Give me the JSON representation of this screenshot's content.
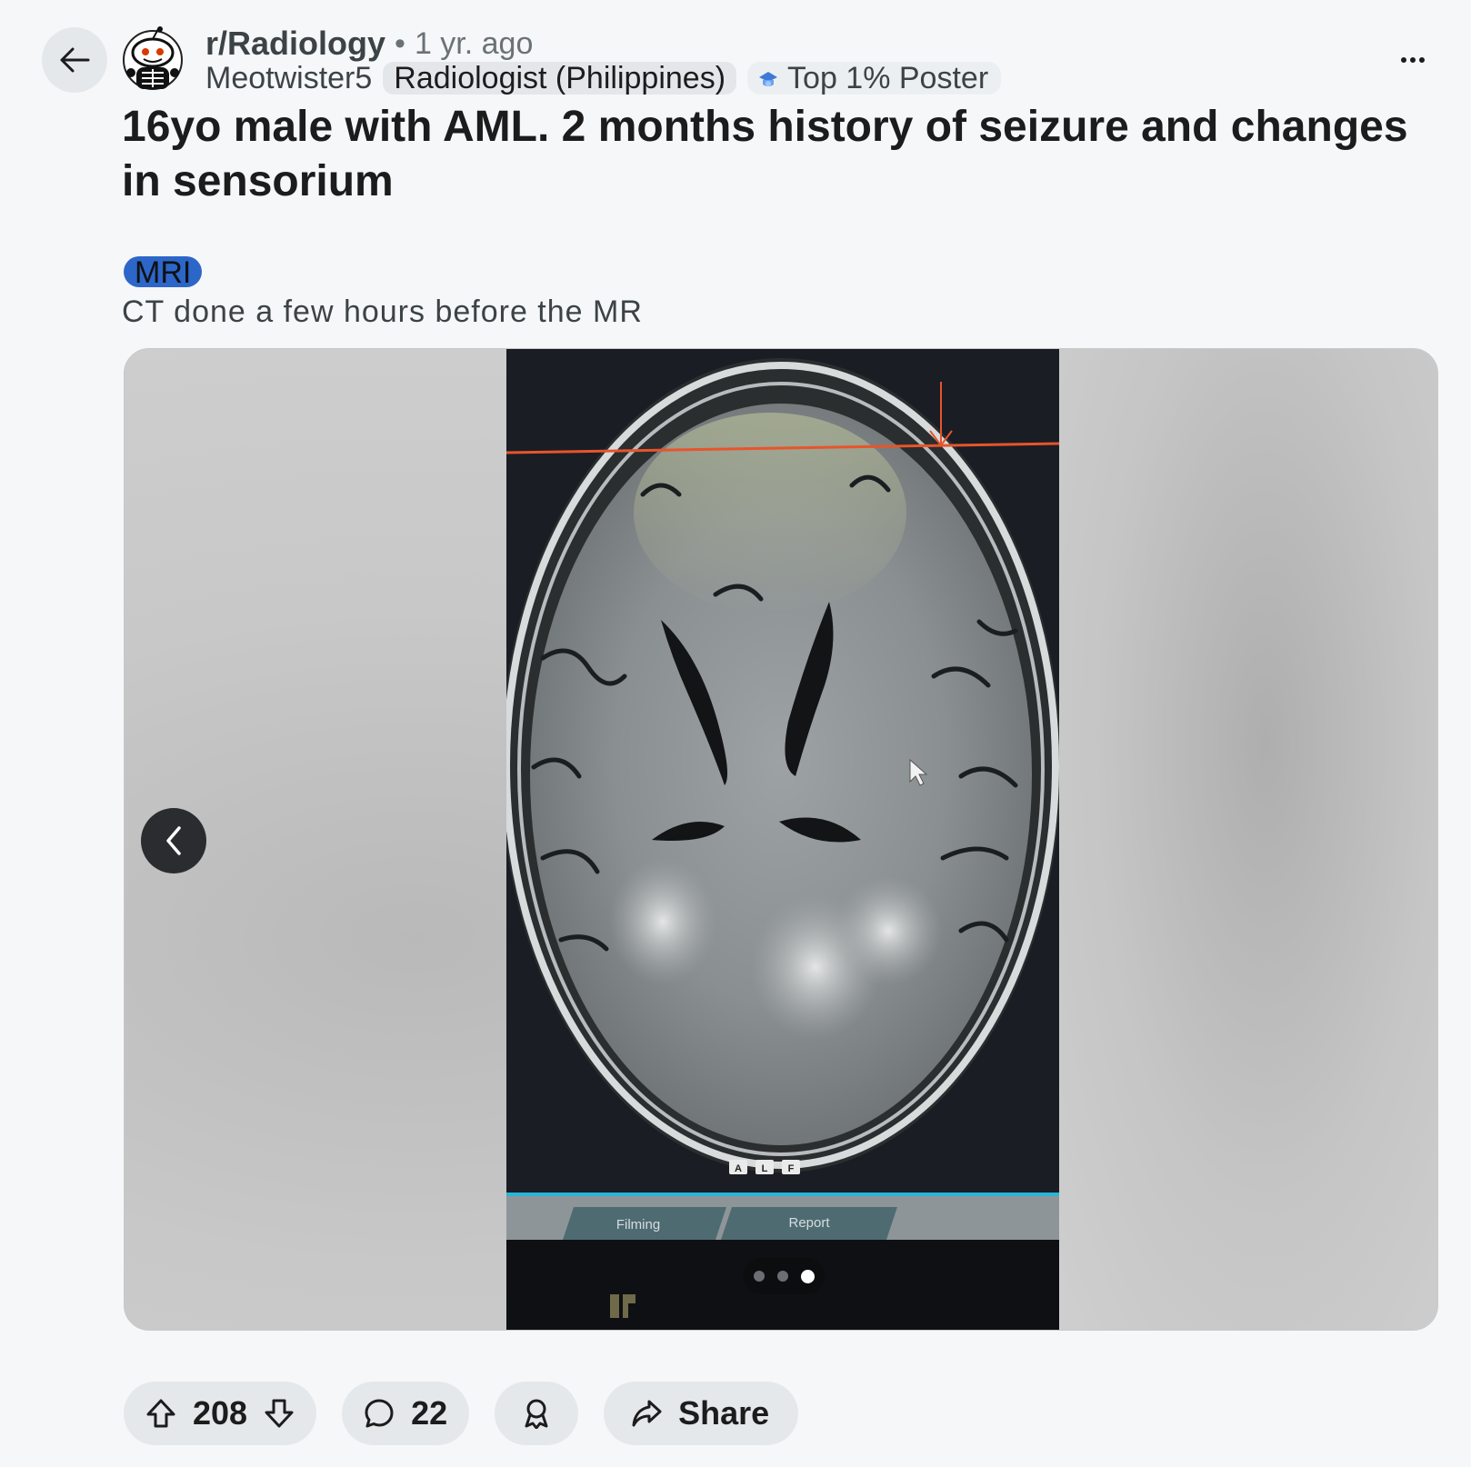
{
  "post": {
    "subreddit": "r/Radiology",
    "separator": "•",
    "time_ago": "1 yr. ago",
    "username": "Meotwister5",
    "user_flair": "Radiologist (Philippines)",
    "badge_label": "Top 1% Poster",
    "title": "16yo male with AML. 2 months history of seizure and changes in sensorium",
    "post_flair": "MRI",
    "body": "CT done a few hours before the MR"
  },
  "media": {
    "scan_orientation_labels": [
      "A",
      "L",
      "F"
    ],
    "viewer_tabs": [
      "Filming",
      "Report"
    ],
    "carousel": {
      "total": 3,
      "active_index": 3
    }
  },
  "actions": {
    "upvotes": "208",
    "comments": "22",
    "share_label": "Share"
  },
  "colors": {
    "post_flair_bg": "#2d66c9",
    "pill_bg": "#e5e8eb",
    "page_bg": "#f6f7f9"
  },
  "icons": [
    "back-arrow-icon",
    "snoo-avatar-icon",
    "top-poster-badge-icon",
    "more-options-icon",
    "chevron-left-icon",
    "upvote-icon",
    "downvote-icon",
    "comment-icon",
    "award-icon",
    "share-icon"
  ]
}
